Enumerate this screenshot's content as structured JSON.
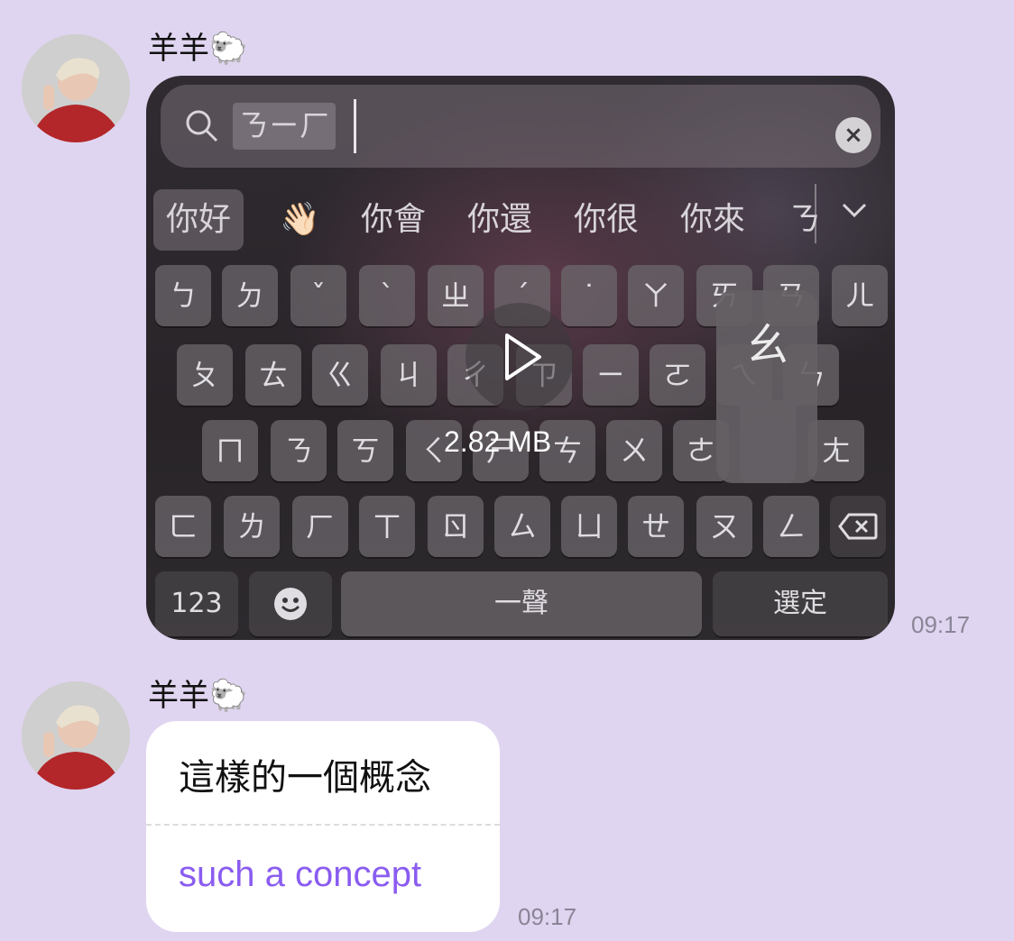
{
  "messages": [
    {
      "sender": "羊羊🐑",
      "time": "09:17",
      "video": {
        "file_size": "2.82 MB",
        "search_text": "ㄋㄧㄏ",
        "candidates": [
          "你好",
          "👋🏻",
          "你會",
          "你還",
          "你很",
          "你來",
          "ㄋ"
        ],
        "rows": [
          [
            "ㄅ",
            "ㄉ",
            "ˇ",
            "ˋ",
            "ㄓ",
            "ˊ",
            "˙",
            "ㄚ",
            "ㄞ",
            "ㄢ",
            "ㄦ"
          ],
          [
            "ㄆ",
            "ㄊ",
            "ㄍ",
            "ㄐ",
            "ㄔ",
            "ㄗ",
            "ㄧ",
            "ㄛ",
            "ㄟ",
            "ㄣ"
          ],
          [
            "ㄇ",
            "ㄋ",
            "ㄎ",
            "ㄑ",
            "ㄕ",
            "ㄘ",
            "ㄨ",
            "ㄜ",
            "ㄠ",
            "ㄤ"
          ],
          [
            "ㄈ",
            "ㄌ",
            "ㄏ",
            "ㄒ",
            "ㄖ",
            "ㄙ",
            "ㄩ",
            "ㄝ",
            "ㄡ",
            "ㄥ"
          ]
        ],
        "popup_key": "ㄠ",
        "key_123": "123",
        "space_label": "一聲",
        "enter_label": "選定"
      }
    },
    {
      "sender": "羊羊🐑",
      "time": "09:17",
      "text": "這樣的一個概念",
      "translation": "such a concept"
    }
  ]
}
